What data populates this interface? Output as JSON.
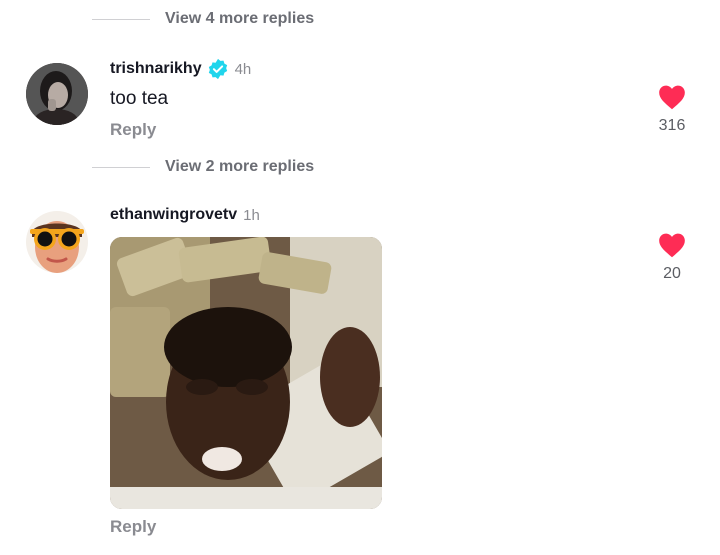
{
  "thread": {
    "view_more_1": "View 4 more replies",
    "view_more_2": "View 2 more replies"
  },
  "comments": [
    {
      "username": "trishnarikhy",
      "verified": true,
      "time": "4h",
      "text": "too tea",
      "reply_label": "Reply",
      "like_count": "316"
    },
    {
      "username": "ethanwingrovetv",
      "verified": false,
      "time": "1h",
      "media": "gif-image",
      "reply_label": "Reply",
      "like_count": "20"
    }
  ],
  "colors": {
    "heart": "#fe2c55",
    "verified": "#20d5ec",
    "muted_text": "#8a8b91"
  }
}
